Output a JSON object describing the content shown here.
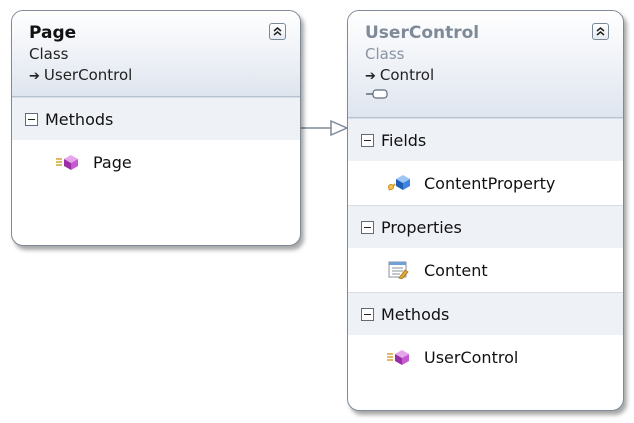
{
  "classes": [
    {
      "title": "Page",
      "kind": "Class",
      "base": "UserControl",
      "sections": [
        {
          "label": "Methods",
          "members": [
            {
              "label": "Page",
              "icon": "method-icon"
            }
          ]
        }
      ]
    },
    {
      "title": "UserControl",
      "kind": "Class",
      "base": "Control",
      "sections": [
        {
          "label": "Fields",
          "members": [
            {
              "label": "ContentProperty",
              "icon": "field-icon"
            }
          ]
        },
        {
          "label": "Properties",
          "members": [
            {
              "label": "Content",
              "icon": "property-icon"
            }
          ]
        },
        {
          "label": "Methods",
          "members": [
            {
              "label": "UserControl",
              "icon": "method-icon"
            }
          ]
        }
      ]
    }
  ],
  "colors": {
    "header_gradient_top": "#ffffff",
    "header_gradient_bottom": "#dfe5ef",
    "section_background": "#eef1f6",
    "border": "#7f8a98",
    "connector": "#7f8a98"
  },
  "relationship": {
    "from": "Page",
    "to": "UserControl",
    "type": "inheritance"
  }
}
